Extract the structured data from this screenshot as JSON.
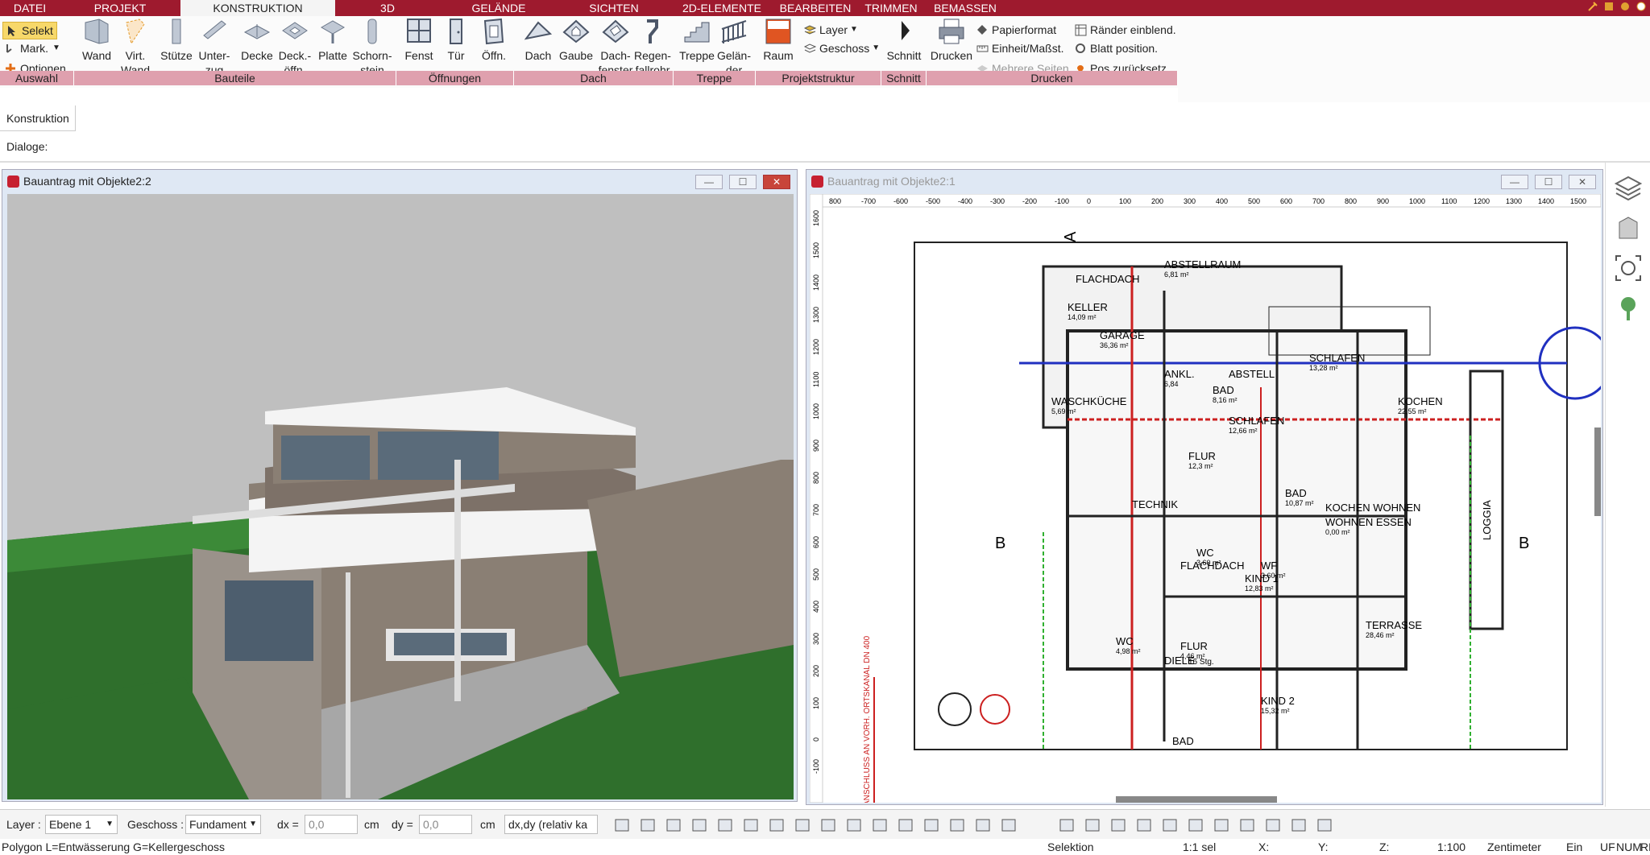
{
  "menu": {
    "tabs": [
      {
        "label": "DATEI",
        "active": false
      },
      {
        "label": "PROJEKT",
        "active": false
      },
      {
        "label": "KONSTRUKTION",
        "active": true
      },
      {
        "label": "3D",
        "active": false
      },
      {
        "label": "GELÄNDE",
        "active": false
      },
      {
        "label": "SICHTEN",
        "active": false
      },
      {
        "label": "2D-ELEMENTE",
        "active": false
      },
      {
        "label": "BEARBEITEN",
        "active": false
      },
      {
        "label": "TRIMMEN",
        "active": false
      },
      {
        "label": "BEMASSEN",
        "active": false
      }
    ],
    "accent": "#9e1a2e"
  },
  "ribbon": {
    "auswahl": {
      "selekt": "Selekt",
      "mark": "Mark.",
      "optionen": "Optionen"
    },
    "buttons": {
      "wand": "Wand",
      "virt_wand": "Virt.\nWand",
      "stuetze": "Stütze",
      "unterzug": "Unter-\nzug",
      "decke": "Decke",
      "deckoeffn": "Deck.-\nöffn.",
      "platte": "Platte",
      "schornstein": "Schorn-\nstein",
      "fenst": "Fenst",
      "tuer": "Tür",
      "oeffn": "Öffn.",
      "dach": "Dach",
      "gaube": "Gaube",
      "dachfenster": "Dach-\nfenster",
      "regenfallrohr": "Regen-\nfallrohr",
      "treppe": "Treppe",
      "gelaender": "Gelän-\nder",
      "raum": "Raum",
      "layer": "Layer",
      "geschoss": "Geschoss",
      "schnitt": "Schnitt",
      "drucken": "Drucken",
      "papierformat": "Papierformat",
      "einheit": "Einheit/Maßst.",
      "mehrere_seiten": "Mehrere Seiten",
      "raender": "Ränder einblend.",
      "blatt": "Blatt position.",
      "pos": "Pos zurücksetz."
    },
    "groups": {
      "auswahl": "Auswahl",
      "bauteile": "Bauteile",
      "oeffnungen": "Öffnungen",
      "dach": "Dach",
      "treppe": "Treppe",
      "projektstruktur": "Projektstruktur",
      "schnitt": "Schnitt",
      "drucken": "Drucken"
    }
  },
  "panel": {
    "konstruktion": "Konstruktion",
    "dialoge": "Dialoge:"
  },
  "windows": {
    "view3d": {
      "title": "Bauantrag mit Objekte2:2"
    },
    "plan": {
      "title": "Bauantrag mit Objekte2:1"
    }
  },
  "plan": {
    "ruler_x": [
      "800",
      "-700",
      "-600",
      "-500",
      "-400",
      "-300",
      "-200",
      "-100",
      "0",
      "100",
      "200",
      "300",
      "400",
      "500",
      "600",
      "700",
      "800",
      "900",
      "1000",
      "1100",
      "1200",
      "1300",
      "1400",
      "1500"
    ],
    "ruler_y": [
      "1600",
      "1500",
      "1400",
      "1300",
      "1200",
      "1100",
      "1000",
      "900",
      "800",
      "700",
      "600",
      "500",
      "400",
      "300",
      "200",
      "100",
      "0",
      "-100"
    ],
    "rooms": [
      {
        "name": "FLACHDACH",
        "area": ""
      },
      {
        "name": "ABSTELLRAUM",
        "area": "6,81 m²"
      },
      {
        "name": "KELLER",
        "area": "14,09 m²"
      },
      {
        "name": "GARAGE",
        "area": "36,36 m²"
      },
      {
        "name": "SCHLAFEN",
        "area": "13,28 m²"
      },
      {
        "name": "ANKL.",
        "area": "6,84"
      },
      {
        "name": "ABSTELL",
        "area": ""
      },
      {
        "name": "BAD",
        "area": "8,16 m²"
      },
      {
        "name": "WASCHKÜCHE",
        "area": "5,69 m²"
      },
      {
        "name": "KOCHEN",
        "area": "22,55 m²"
      },
      {
        "name": "SCHLAFEN",
        "area": "12,66 m²"
      },
      {
        "name": "FLUR",
        "area": "12,3 m²"
      },
      {
        "name": "BAD",
        "area": "10,87 m²"
      },
      {
        "name": "KOCHEN WOHNEN",
        "area": ""
      },
      {
        "name": "WOHNEN ESSEN",
        "area": "0,00 m²"
      },
      {
        "name": "TECHNIK",
        "area": ""
      },
      {
        "name": "WC",
        "area": "3,60 m²"
      },
      {
        "name": "FLACHDACH",
        "area": ""
      },
      {
        "name": "WF",
        "area": "3,60 m²"
      },
      {
        "name": "KIND 1",
        "area": "12,83 m²"
      },
      {
        "name": "LOGGIA",
        "area": ""
      },
      {
        "name": "TERRASSE",
        "area": "28,46 m²"
      },
      {
        "name": "FLUR",
        "area": "4,46 m²"
      },
      {
        "name": "WC",
        "area": "4,98 m²"
      },
      {
        "name": "DIELE",
        "area": ""
      },
      {
        "name": "KIND 2",
        "area": "15,32 m²"
      },
      {
        "name": "BAD",
        "area": ""
      }
    ],
    "marks": {
      "a": "A",
      "b": "B",
      "vertical": "ANSCHLUSS AN VORH. ORTSKANAL DN 400",
      "stufen": "16 Stg."
    }
  },
  "status": {
    "layer_label": "Layer :",
    "layer_value": "Ebene 1",
    "geschoss_label": "Geschoss :",
    "geschoss_value": "Fundament",
    "dx_label": "dx =",
    "dx_value": "0,0",
    "dx_unit": "cm",
    "dy_label": "dy =",
    "dy_value": "0,0",
    "dy_unit": "cm",
    "mode": "dx,dy (relativ ka"
  },
  "bottom": {
    "info": "Polygon L=Entwässerung G=Kellergeschoss",
    "selektion": "Selektion",
    "sel": "1:1 sel",
    "x": "X:",
    "y": "Y:",
    "z": "Z:",
    "scale": "1:100",
    "unit": "Zentimeter",
    "ein": "Ein",
    "uf": "UF",
    "num": "NUM",
    "rf": "RF"
  }
}
